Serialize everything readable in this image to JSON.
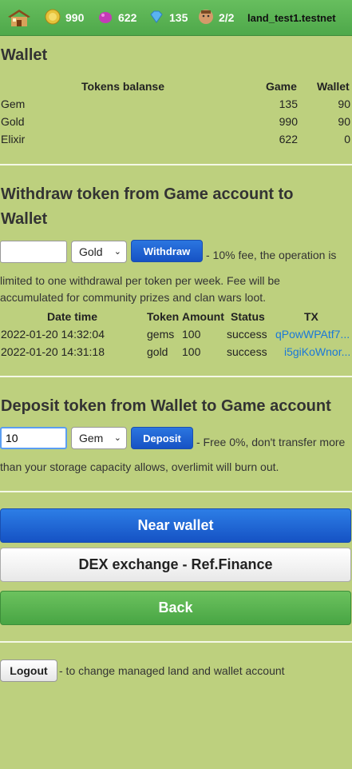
{
  "topbar": {
    "coins": "990",
    "gems": "622",
    "diamonds": "135",
    "population": "2/2",
    "account": "land_test1.testnet"
  },
  "wallet": {
    "title": "Wallet",
    "headers": {
      "name": "Tokens balanse",
      "game": "Game",
      "wallet": "Wallet"
    },
    "rows": [
      {
        "name": "Gem",
        "game": "135",
        "wallet": "90"
      },
      {
        "name": "Gold",
        "game": "990",
        "wallet": "90"
      },
      {
        "name": "Elixir",
        "game": "622",
        "wallet": "0"
      }
    ]
  },
  "withdraw": {
    "title_line1": "Withdraw token from Game account to",
    "title_line2": "Wallet",
    "amount_value": "",
    "token_selected": "Gold",
    "button": "Withdraw",
    "note_line1": "- 10% fee, the operation is",
    "note_line2": "limited to one withdrawal per token per week. Fee will be",
    "note_line3": "accumulated for community prizes and clan wars loot.",
    "table_headers": {
      "date": "Date time",
      "token": "Token",
      "amount": "Amount",
      "status": "Status",
      "tx": "TX"
    },
    "table_rows": [
      {
        "date": "2022-01-20 14:32:04",
        "token": "gems",
        "amount": "100",
        "status": "success",
        "tx": "qPowWPAtf7..."
      },
      {
        "date": "2022-01-20 14:31:18",
        "token": "gold",
        "amount": "100",
        "status": "success",
        "tx": "i5giKoWnor..."
      }
    ]
  },
  "deposit": {
    "title": "Deposit token from Wallet to Game account",
    "amount_value": "10",
    "token_selected": "Gem",
    "button": "Deposit",
    "note_line1": "- Free 0%, don't transfer more",
    "note_line2": "than your storage capacity allows, overlimit will burn out."
  },
  "actions": {
    "near_wallet": "Near wallet",
    "dex": "DEX exchange - Ref.Finance",
    "back": "Back"
  },
  "logout": {
    "button": "Logout",
    "note": "- to change managed land and wallet account"
  },
  "colors": {
    "background": "#bdd07e",
    "topbar": "#55ad50",
    "accent_blue": "#1f62d2",
    "link": "#1a78d8"
  }
}
